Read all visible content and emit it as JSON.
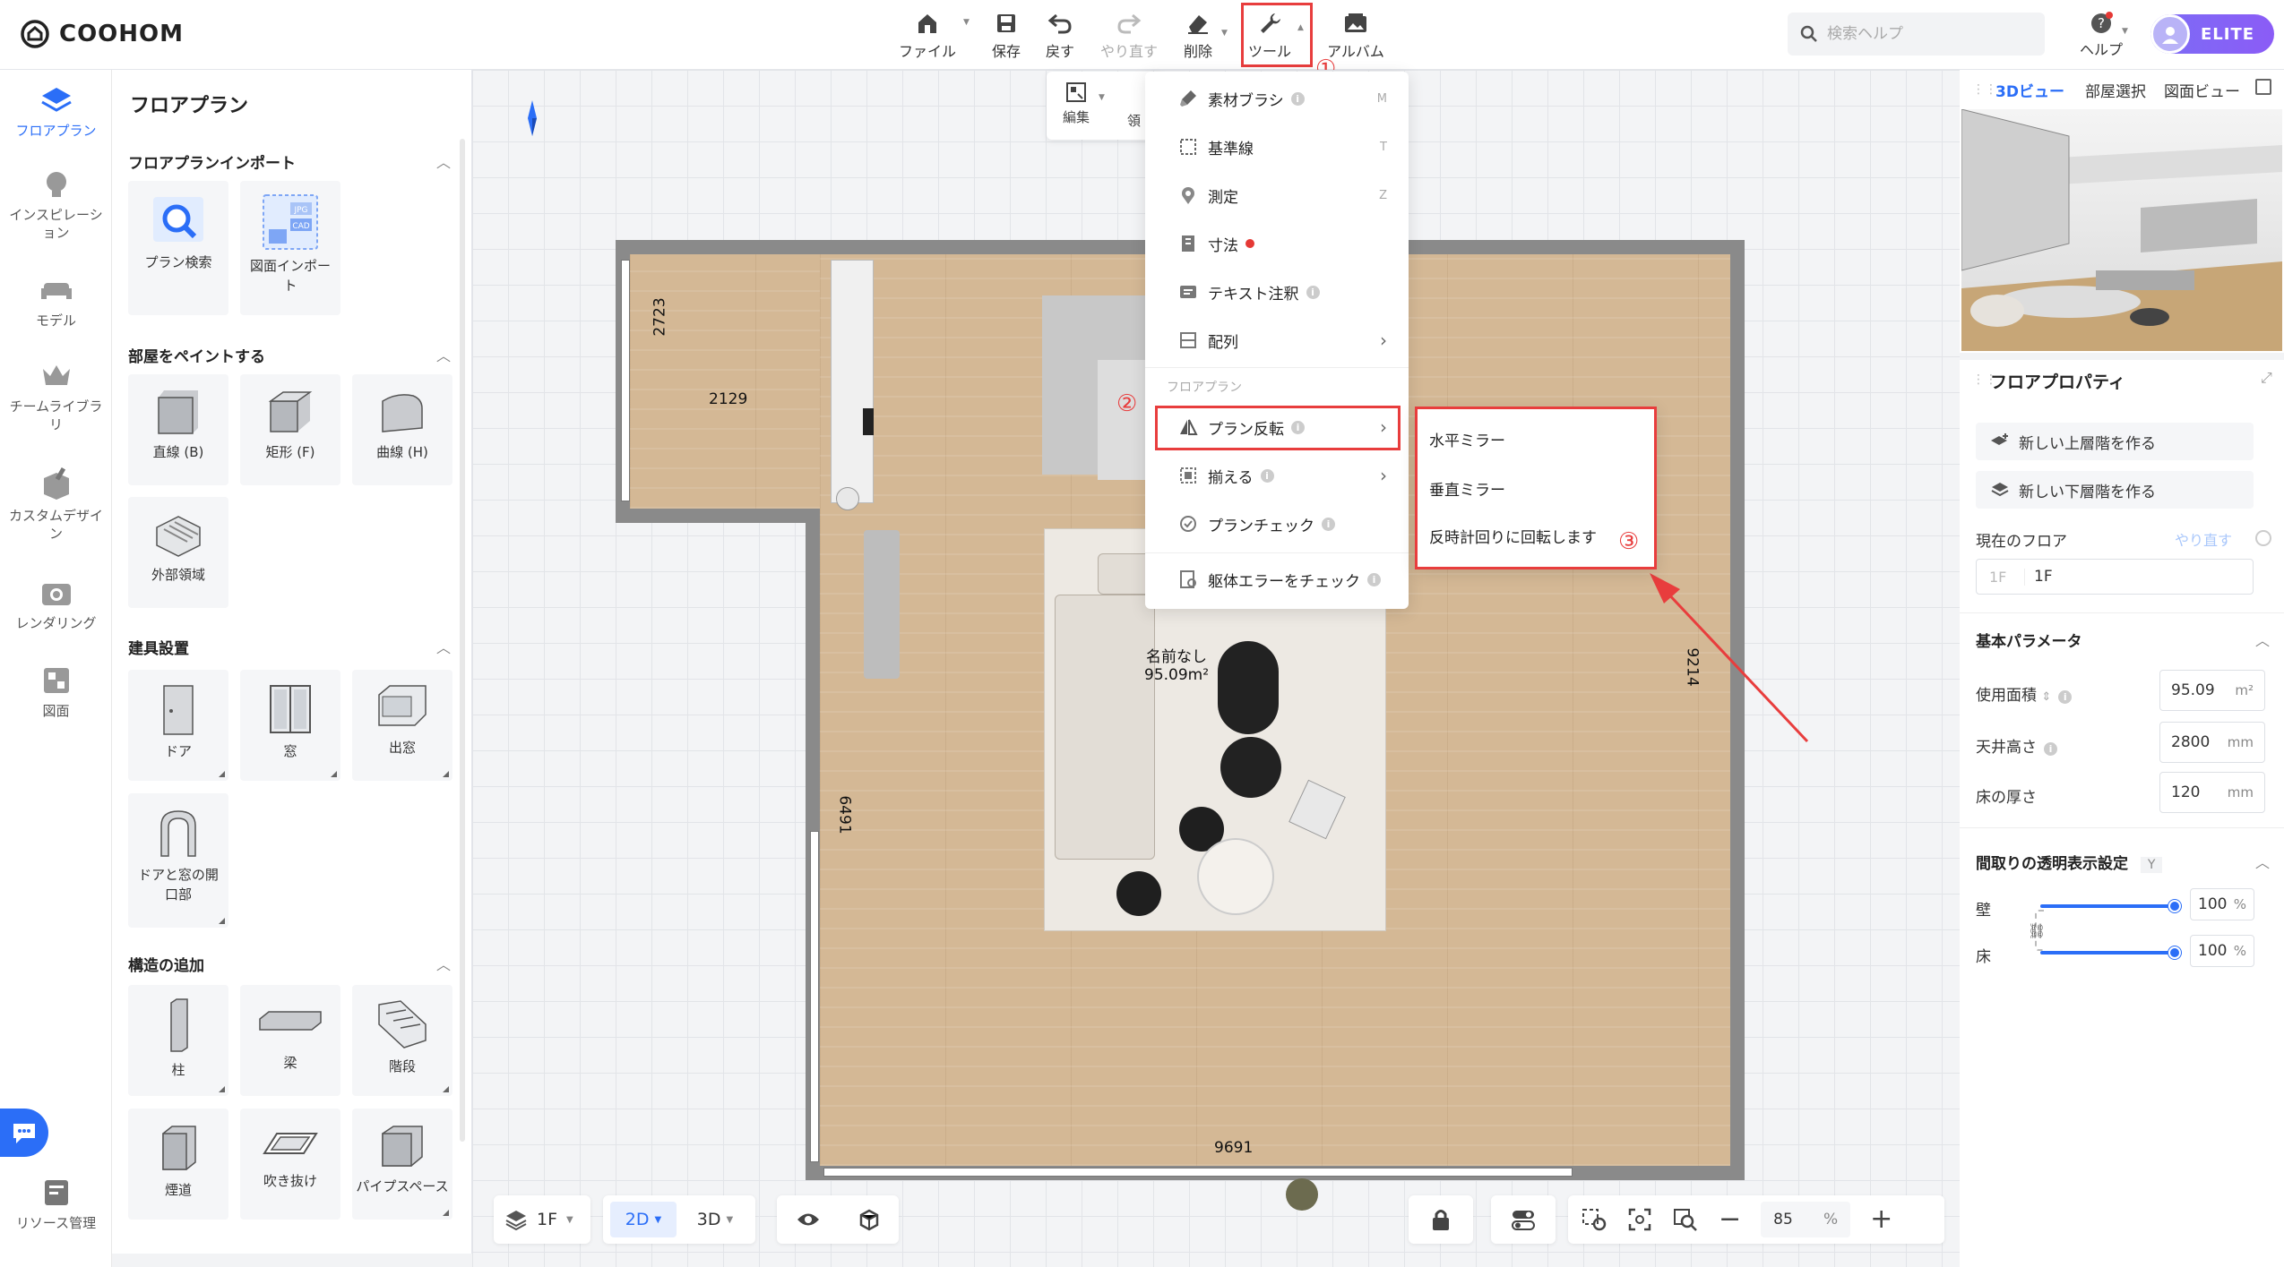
{
  "app": {
    "logo": "COOHOM"
  },
  "toolbar": {
    "file": "ファイル",
    "save": "保存",
    "undo": "戻す",
    "redo": "やり直す",
    "delete": "削除",
    "tools": "ツール",
    "album": "アルバム",
    "search_placeholder": "検索ヘルプ",
    "help": "ヘルプ",
    "badge": "ELITE"
  },
  "rail": [
    {
      "label": "フロアプラン",
      "icon": "floorplan-icon"
    },
    {
      "label": "インスピレーション",
      "icon": "lightbulb-icon"
    },
    {
      "label": "モデル",
      "icon": "sofa-icon"
    },
    {
      "label": "チームライブラリ",
      "icon": "crown-icon"
    },
    {
      "label": "カスタムデザイン",
      "icon": "box-tool-icon"
    },
    {
      "label": "レンダリング",
      "icon": "camera-icon"
    },
    {
      "label": "図面",
      "icon": "drawing-icon"
    },
    {
      "label": "リソース管理",
      "icon": "resource-icon"
    }
  ],
  "panel": {
    "title": "フロアプラン",
    "import": {
      "title": "フロアプランインポート",
      "items": [
        "プラン検索",
        "図面インポート"
      ],
      "jpg": "JPG",
      "cad": "CAD"
    },
    "paint": {
      "title": "部屋をペイントする",
      "items": [
        "直線 (B)",
        "矩形 (F)",
        "曲線 (H)",
        "外部領域"
      ]
    },
    "fixtures": {
      "title": "建具設置",
      "items": [
        "ドア",
        "窓",
        "出窓",
        "ドアと窓の開口部"
      ]
    },
    "structure": {
      "title": "構造の追加",
      "items": [
        "柱",
        "梁",
        "階段",
        "煙道",
        "吹き抜け",
        "パイプスペース"
      ]
    }
  },
  "canvas": {
    "dims": {
      "top": "2723",
      "left_top": "2129",
      "left": "6491",
      "right": "9214",
      "bottom": "9691"
    },
    "room_name": "名前なし",
    "room_area": "95.09m²",
    "subtoolbar": {
      "edit": "編集",
      "partial": "領"
    }
  },
  "tools_menu": {
    "items": [
      {
        "label": "素材ブラシ",
        "key": "M",
        "icon": "brush-icon"
      },
      {
        "label": "基準線",
        "key": "T",
        "icon": "guideline-icon"
      },
      {
        "label": "測定",
        "key": "Z",
        "icon": "measure-icon"
      },
      {
        "label": "寸法",
        "icon": "dimension-icon"
      },
      {
        "label": "テキスト注釈",
        "icon": "text-note-icon"
      },
      {
        "label": "配列",
        "icon": "array-icon"
      }
    ],
    "section": "フロアプラン",
    "items2": [
      {
        "label": "プラン反転",
        "icon": "flip-icon"
      },
      {
        "label": "揃える",
        "icon": "align-icon"
      },
      {
        "label": "プランチェック",
        "icon": "plan-check-icon"
      },
      {
        "label": "躯体エラーをチェック",
        "icon": "error-check-icon"
      }
    ]
  },
  "flip_menu": {
    "items": [
      "水平ミラー",
      "垂直ミラー",
      "反時計回りに回転します"
    ]
  },
  "annotations": {
    "n1": "①",
    "n2": "②",
    "n3": "③",
    "accent": "#e83d3d"
  },
  "bottombar": {
    "floor": "1F",
    "mode2d": "2D",
    "mode3d": "3D",
    "zoom": "85",
    "zoom_unit": "%"
  },
  "right": {
    "tabs": [
      "3Dビュー",
      "部屋選択",
      "図面ビュー"
    ],
    "props_title": "フロアプロパティ",
    "new_upper": "新しい上層階を作る",
    "new_lower": "新しい下層階を作る",
    "current_floor": "現在のフロア",
    "redo": "やり直す",
    "floor_prefix": "1F",
    "floor_value": "1F",
    "basic": "基本パラメータ",
    "area_label": "使用面積",
    "area_value": "95.09",
    "area_unit": "m²",
    "ceiling_label": "天井高さ",
    "ceiling_value": "2800",
    "ceiling_unit": "mm",
    "floor_thick_label": "床の厚さ",
    "floor_thick_value": "120",
    "floor_thick_unit": "mm",
    "transparency": "間取りの透明表示設定",
    "transparency_key": "Y",
    "wall": "壁",
    "wall_value": "100",
    "floor": "床",
    "floor_value2": "100",
    "pct": "%",
    "wall_level": 1.0,
    "floor_level": 1.0
  }
}
